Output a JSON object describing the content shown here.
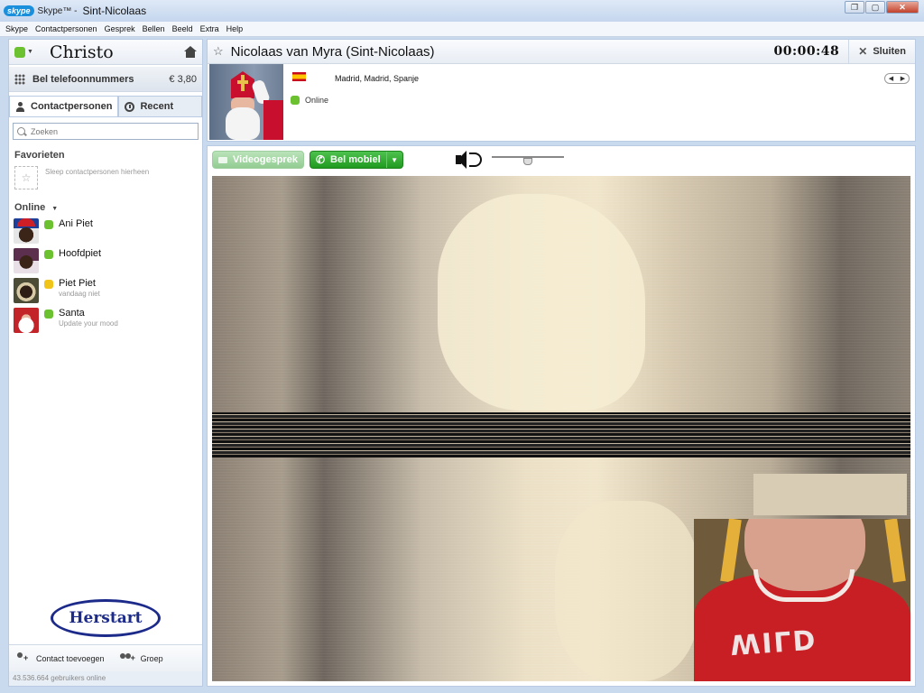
{
  "window": {
    "app_title": "Skype™ -",
    "conversation_title": "Sint-Nicolaas",
    "logo_text": "skype",
    "controls": [
      "restore",
      "maximize",
      "close"
    ]
  },
  "menu": [
    "Skype",
    "Contactpersonen",
    "Gesprek",
    "Bellen",
    "Beeld",
    "Extra",
    "Help"
  ],
  "user": {
    "name": "Christo",
    "status": "online",
    "status_color": "#6bc12f"
  },
  "call_phones": {
    "label": "Bel telefoonnummers",
    "credit": "€ 3,80"
  },
  "tabs": {
    "contacts": "Contactpersonen",
    "recent": "Recent"
  },
  "search": {
    "placeholder": "Zoeken"
  },
  "favorites": {
    "title": "Favorieten",
    "hint": "Sleep contactpersonen hierheen"
  },
  "online": {
    "title": "Online",
    "contacts": [
      {
        "name": "Ani Piet",
        "mood": "",
        "status": "online"
      },
      {
        "name": "Hoofdpiet",
        "mood": "",
        "status": "online"
      },
      {
        "name": "Piet Piet",
        "mood": "vandaag niet",
        "status": "away"
      },
      {
        "name": "Santa",
        "mood": "Update your mood",
        "status": "online"
      }
    ]
  },
  "restart_label": "Herstart",
  "footer": {
    "add_contact": "Contact toevoegen",
    "group": "Groep",
    "users_online": "43.536.664 gebruikers online"
  },
  "conversation": {
    "name": "Nicolaas van Myra (Sint-Nicolaas)",
    "timer": "00:00:48",
    "close_label": "Sluiten",
    "location": "Madrid, Madrid, Spanje",
    "country_flag": "spain",
    "status": "Online"
  },
  "call_controls": {
    "video_label": "Videogesprek",
    "mobile_label": "Bel mobiel",
    "volume_level": 0.5
  },
  "colors": {
    "accent_green": "#1f9a1f",
    "online_green": "#6bc12f",
    "away_yellow": "#f0c419",
    "restart_blue": "#1c2a8a"
  }
}
